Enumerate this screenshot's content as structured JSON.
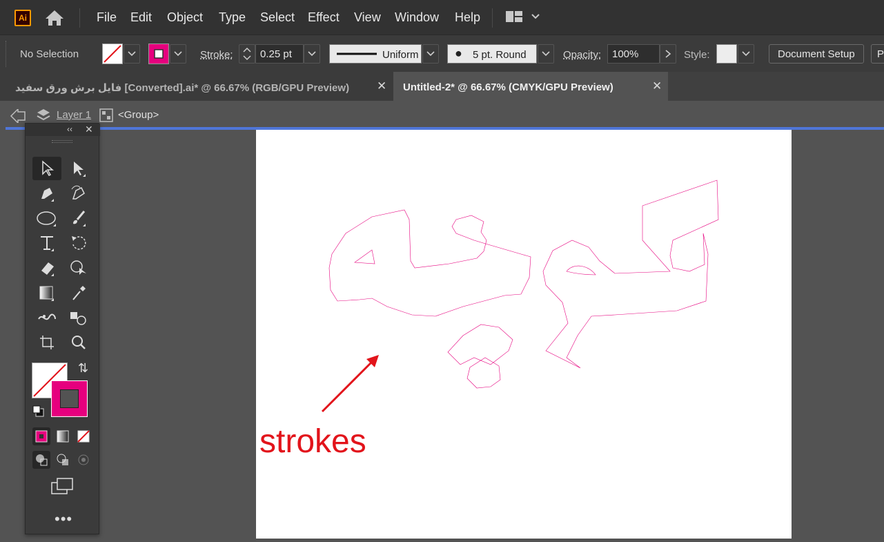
{
  "app": {
    "logo_text": "Ai"
  },
  "menu": [
    "File",
    "Edit",
    "Object",
    "Type",
    "Select",
    "Effect",
    "View",
    "Window",
    "Help"
  ],
  "control_bar": {
    "selection": "No Selection",
    "stroke_label": "Stroke:",
    "stroke_value": "0.25 pt",
    "profile": "Uniform",
    "brush": "5 pt. Round",
    "opacity_label": "Opacity:",
    "opacity_value": "100%",
    "style_label": "Style:",
    "doc_setup": "Document Setup",
    "prefs_partial": "P"
  },
  "tabs": [
    {
      "label": "فایل برش ورق سفید [Converted].ai* @ 66.67% (RGB/GPU Preview)",
      "active": false
    },
    {
      "label": "Untitled-2* @ 66.67% (CMYK/GPU Preview)",
      "active": true
    }
  ],
  "breadcrumb": {
    "layer": "Layer 1",
    "group": "<Group>"
  },
  "annotation": {
    "text": "strokes"
  },
  "colors": {
    "stroke": "#e6007e",
    "accent_blue": "#4f76d8",
    "annotation_red": "#e2141b"
  }
}
